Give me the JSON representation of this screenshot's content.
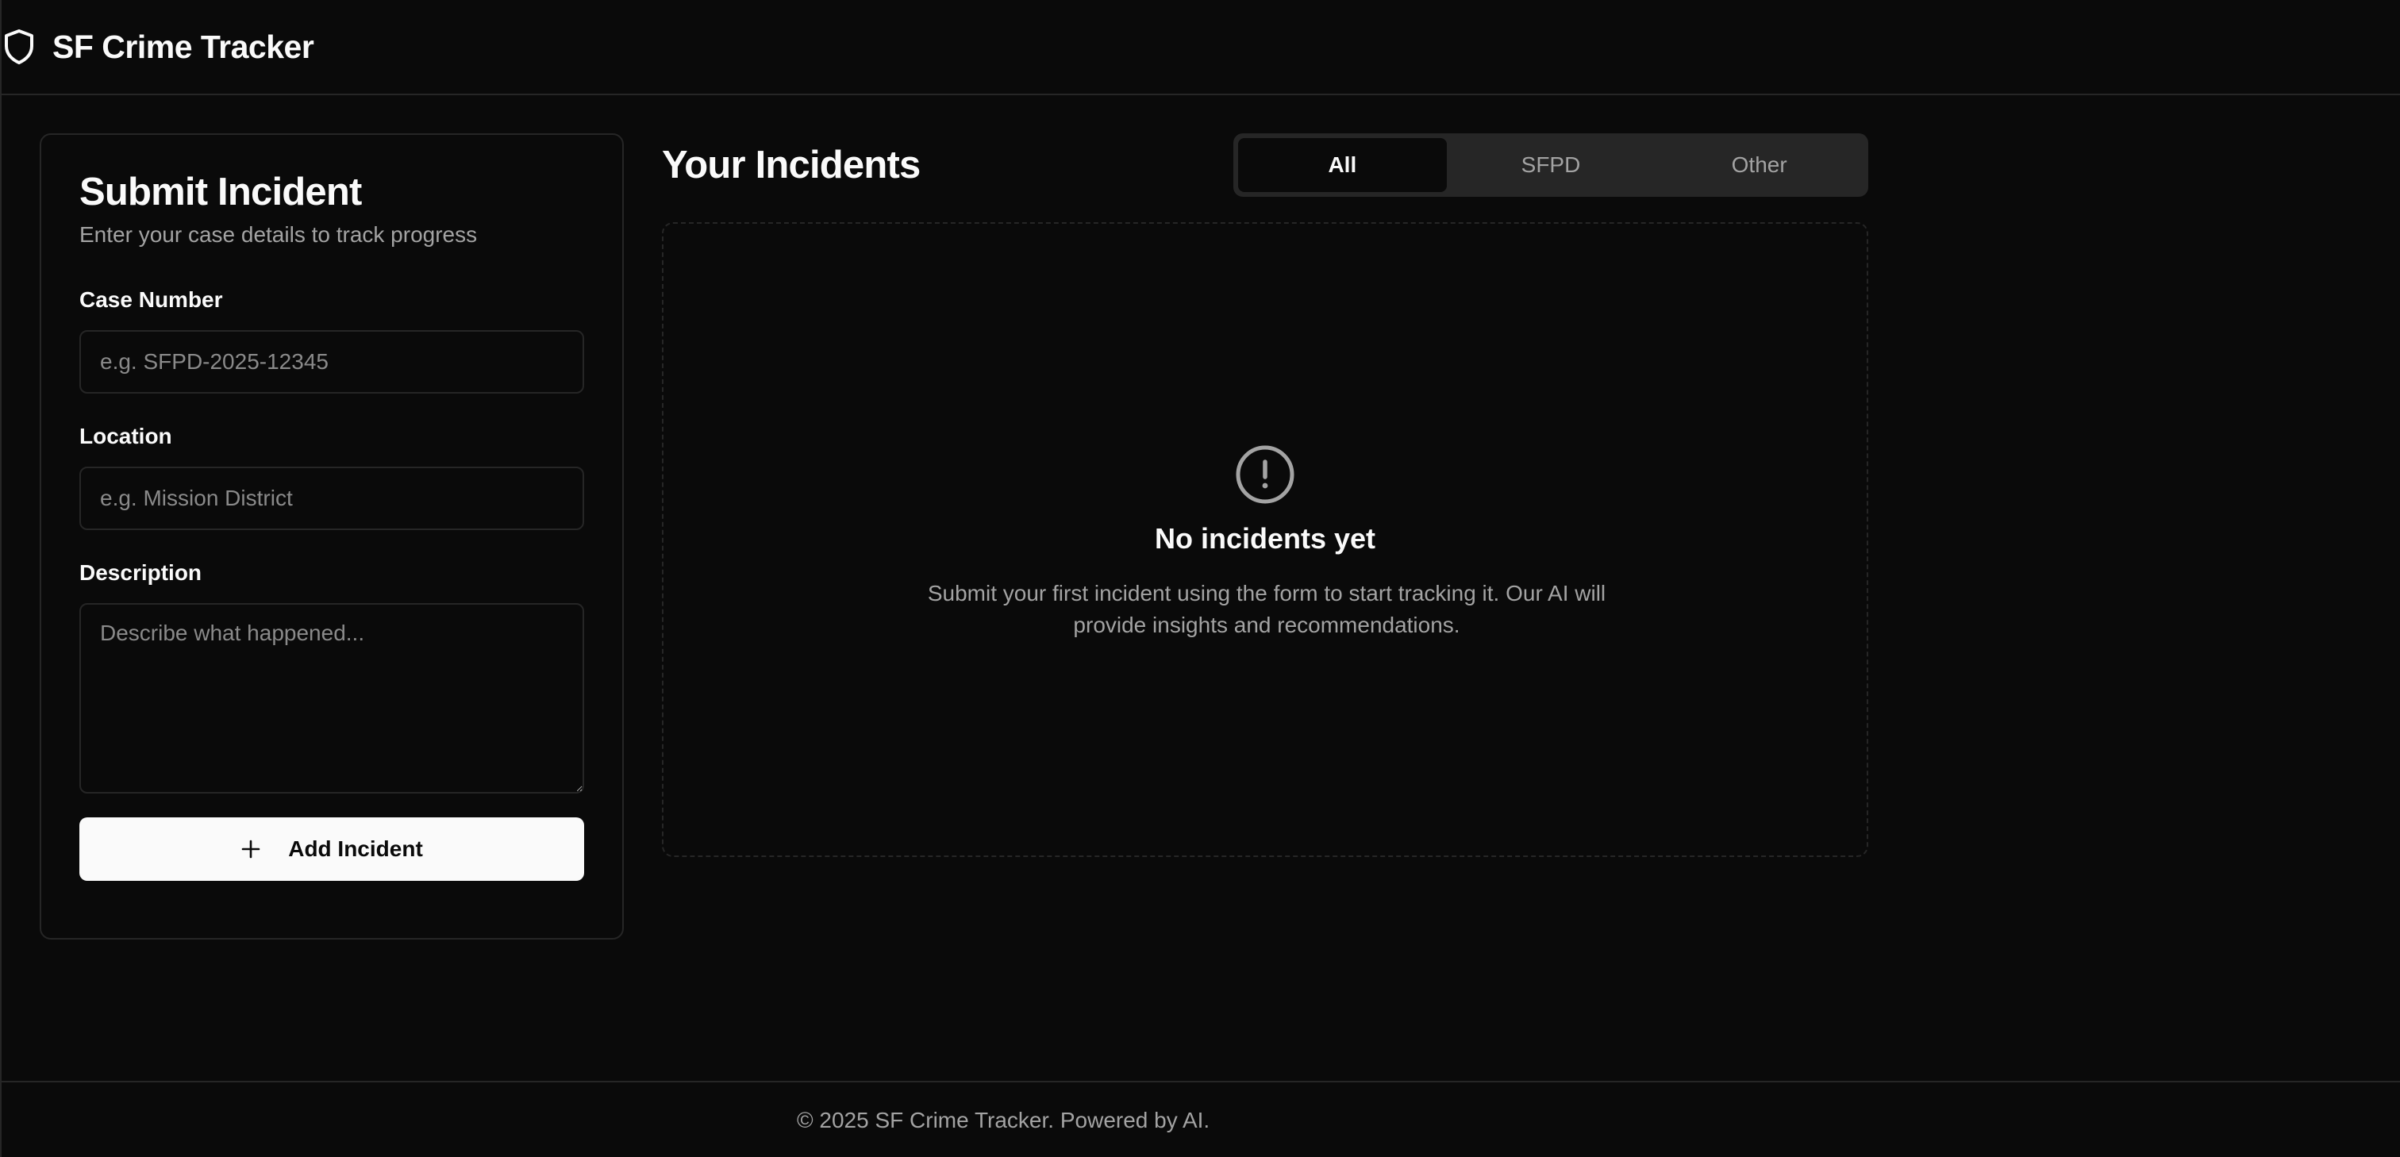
{
  "header": {
    "title": "SF Crime Tracker",
    "icon": "shield-icon"
  },
  "form": {
    "title": "Submit Incident",
    "subtitle": "Enter your case details to track progress",
    "case_number": {
      "label": "Case Number",
      "value": "",
      "placeholder": "e.g. SFPD-2025-12345"
    },
    "location": {
      "label": "Location",
      "value": "",
      "placeholder": "e.g. Mission District"
    },
    "description": {
      "label": "Description",
      "value": "",
      "placeholder": "Describe what happened..."
    },
    "submit_label": "Add Incident",
    "submit_icon": "plus-icon"
  },
  "incidents": {
    "title": "Your Incidents",
    "tabs": [
      {
        "label": "All",
        "active": true
      },
      {
        "label": "SFPD",
        "active": false
      },
      {
        "label": "Other",
        "active": false
      }
    ],
    "empty_state": {
      "icon": "alert-circle-icon",
      "title": "No incidents yet",
      "message": "Submit your first incident using the form to start tracking it. Our AI will provide insights and recommendations."
    }
  },
  "footer": {
    "text": "© 2025 SF Crime Tracker. Powered by AI."
  },
  "colors": {
    "background": "#0a0a0a",
    "border": "#262626",
    "foreground": "#fafafa",
    "muted": "#a3a3a3",
    "tab_track": "#262626"
  }
}
